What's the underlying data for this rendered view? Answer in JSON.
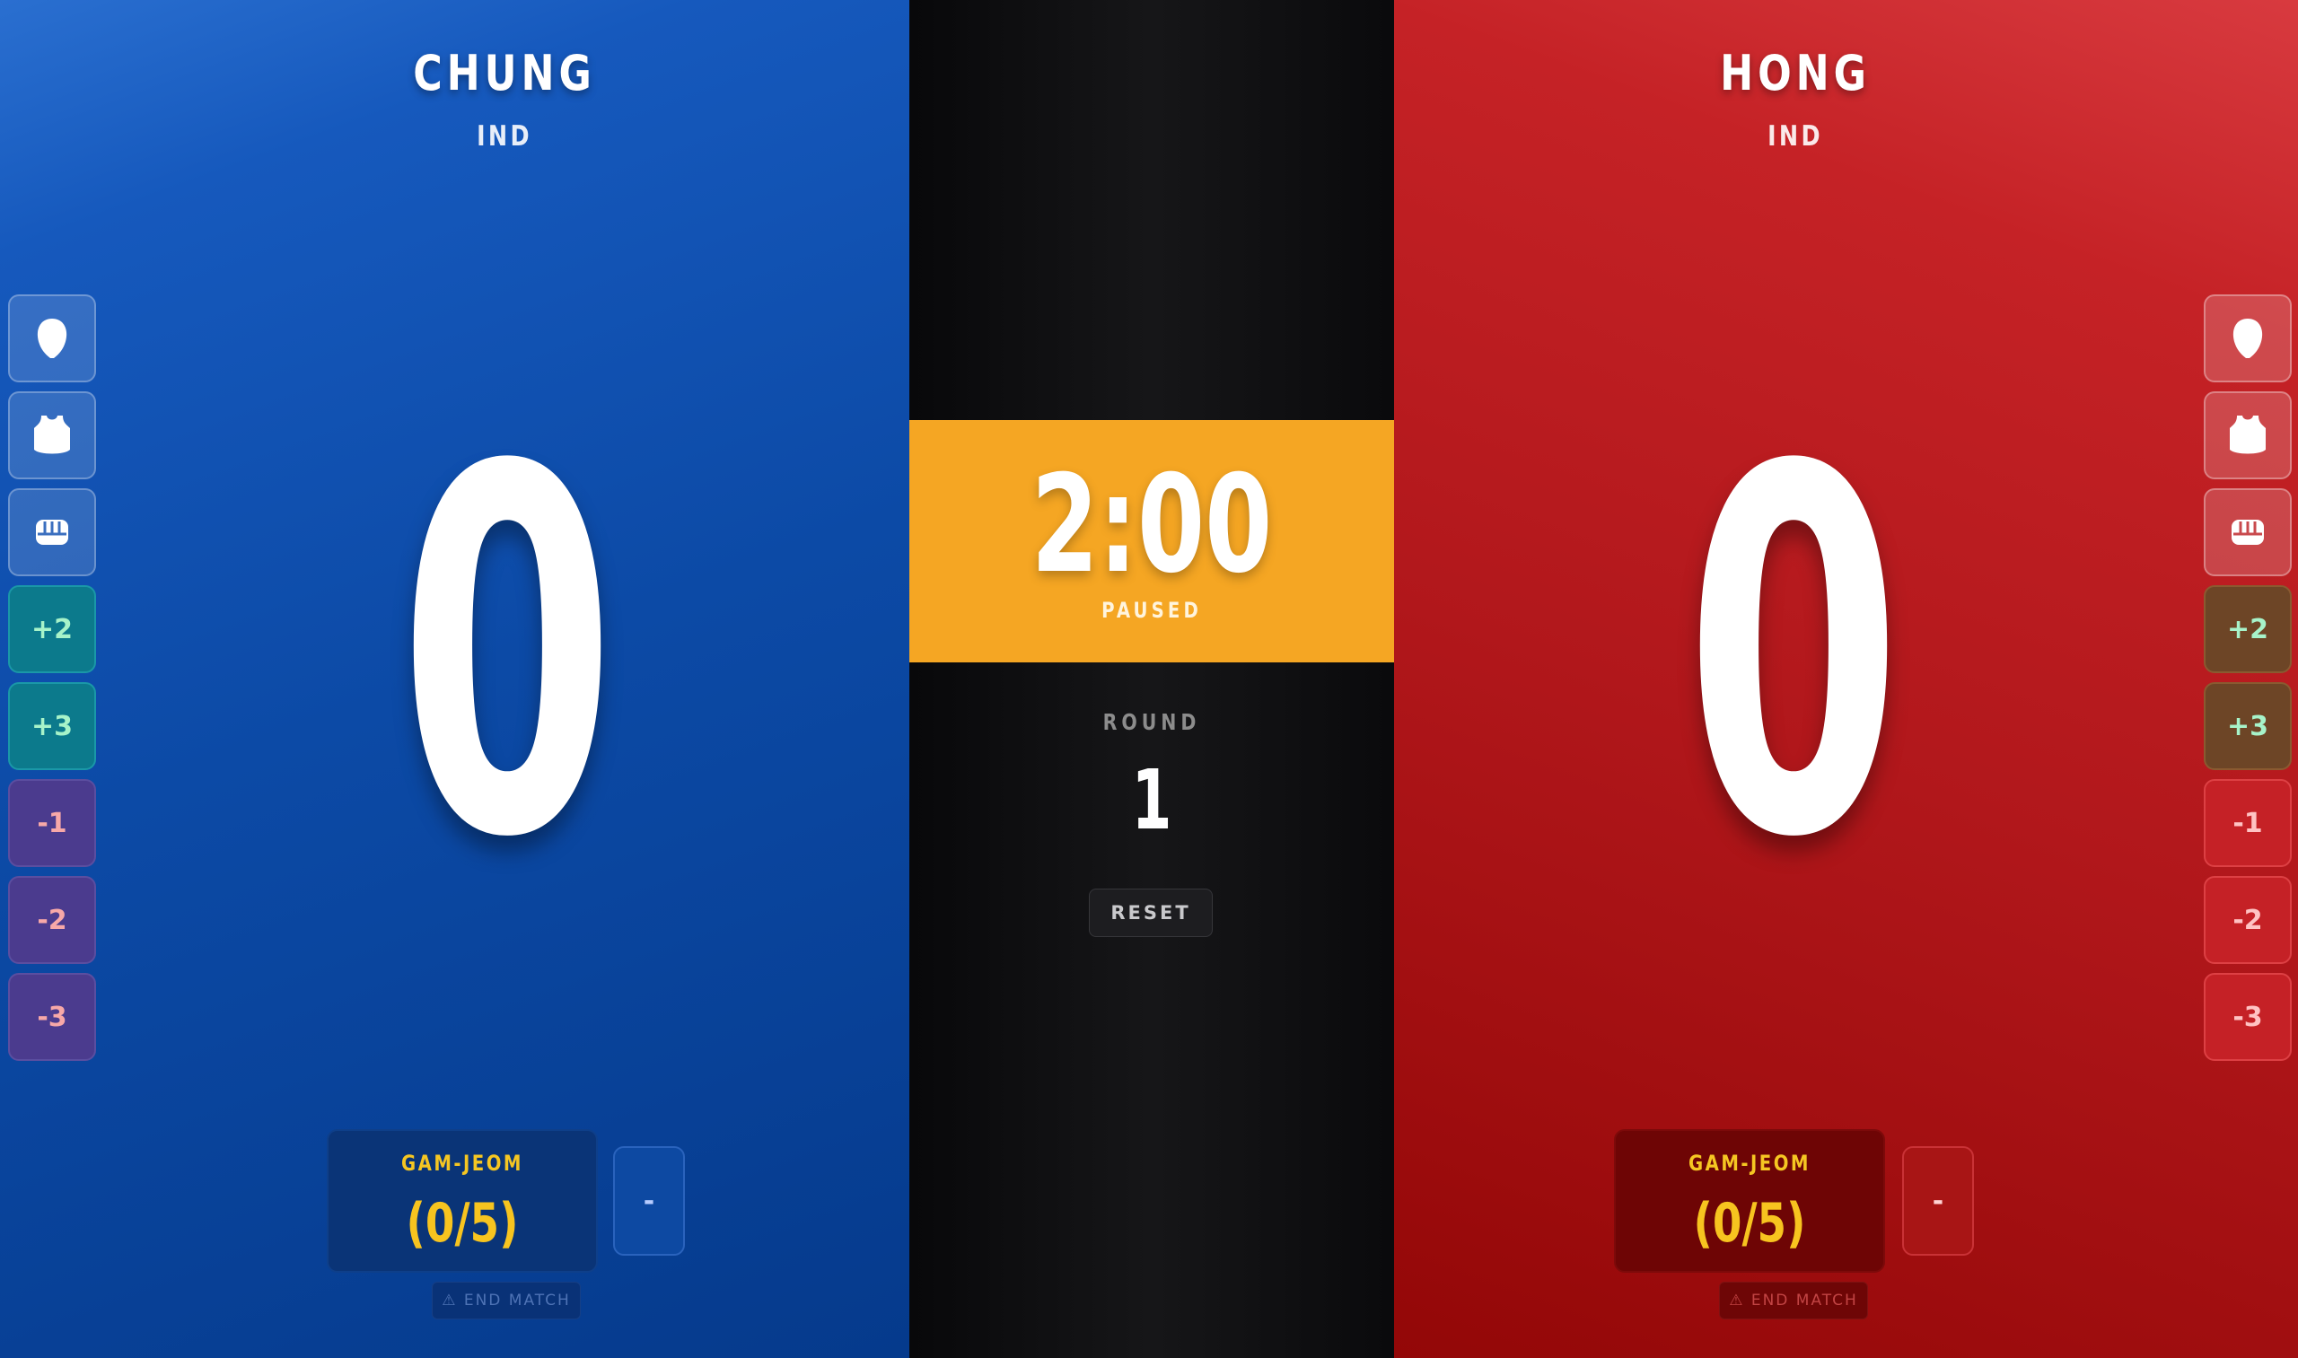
{
  "blue": {
    "name": "CHUNG",
    "country": "IND",
    "score": "0",
    "techniques": [
      {
        "label": "",
        "icon": "head-icon"
      },
      {
        "label": "",
        "icon": "body-protector-icon"
      },
      {
        "label": "",
        "icon": "punch-icon"
      },
      {
        "label": "+2"
      },
      {
        "label": "+3"
      },
      {
        "label": "-1"
      },
      {
        "label": "-2"
      },
      {
        "label": "-3"
      }
    ],
    "gamjeom_label": "GAM-JEOM",
    "gamjeom_count": "(0/5)",
    "gamjeom_minus": "-",
    "end_match": "⚠ END MATCH"
  },
  "red": {
    "name": "HONG",
    "country": "IND",
    "score": "0",
    "techniques": [
      {
        "label": "",
        "icon": "head-icon"
      },
      {
        "label": "",
        "icon": "body-protector-icon"
      },
      {
        "label": "",
        "icon": "punch-icon"
      },
      {
        "label": "+2"
      },
      {
        "label": "+3"
      },
      {
        "label": "-1"
      },
      {
        "label": "-2"
      },
      {
        "label": "-3"
      }
    ],
    "gamjeom_label": "GAM-JEOM",
    "gamjeom_count": "(0/5)",
    "gamjeom_minus": "-",
    "end_match": "⚠ END MATCH"
  },
  "center": {
    "timer": "2:00",
    "status": "PAUSED",
    "round_label": "ROUND",
    "round": "1",
    "reset": "RESET"
  },
  "colors": {
    "blue": "#0c4aa6",
    "red": "#b1171b",
    "timer_band": "#f5a623",
    "gamjeom_text": "#f7c41f"
  }
}
